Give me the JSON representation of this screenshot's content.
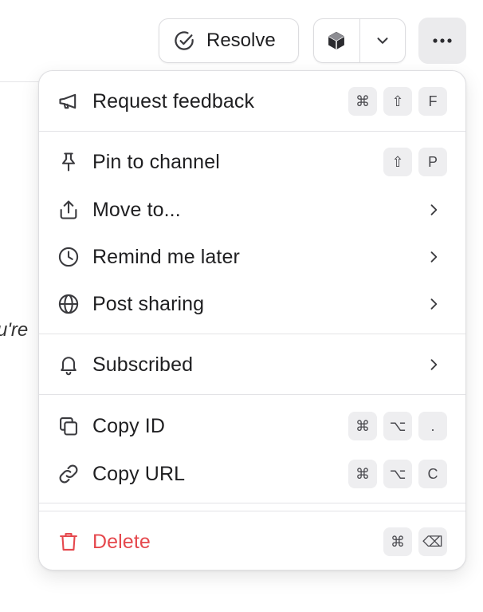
{
  "background": {
    "partial_text": "u're"
  },
  "toolbar": {
    "resolve_label": "Resolve",
    "resolve_icon": "check-circle-icon",
    "cube_icon": "cube-icon",
    "dropdown_icon": "chevron-down-icon",
    "more_icon": "ellipsis-icon"
  },
  "menu": {
    "items": [
      {
        "label": "Request feedback",
        "icon": "megaphone-icon",
        "keys": [
          "⌘",
          "⇧",
          "F"
        ]
      },
      {
        "label": "Pin to channel",
        "icon": "pin-icon",
        "keys": [
          "⇧",
          "P"
        ]
      },
      {
        "label": "Move to...",
        "icon": "share-upload-icon",
        "submenu": true
      },
      {
        "label": "Remind me later",
        "icon": "clock-icon",
        "submenu": true
      },
      {
        "label": "Post sharing",
        "icon": "globe-icon",
        "submenu": true
      },
      {
        "label": "Subscribed",
        "icon": "bell-icon",
        "submenu": true
      },
      {
        "label": "Copy ID",
        "icon": "copy-icon",
        "keys": [
          "⌘",
          "⌥",
          "."
        ]
      },
      {
        "label": "Copy URL",
        "icon": "link-icon",
        "keys": [
          "⌘",
          "⌥",
          "C"
        ]
      },
      {
        "label": "Delete",
        "icon": "trash-icon",
        "keys": [
          "⌘",
          "⌫"
        ],
        "danger": true
      }
    ]
  },
  "colors": {
    "danger": "#e5484d",
    "text": "#1f1f21",
    "key_bg": "#eeeef0",
    "border": "#dedee1"
  }
}
